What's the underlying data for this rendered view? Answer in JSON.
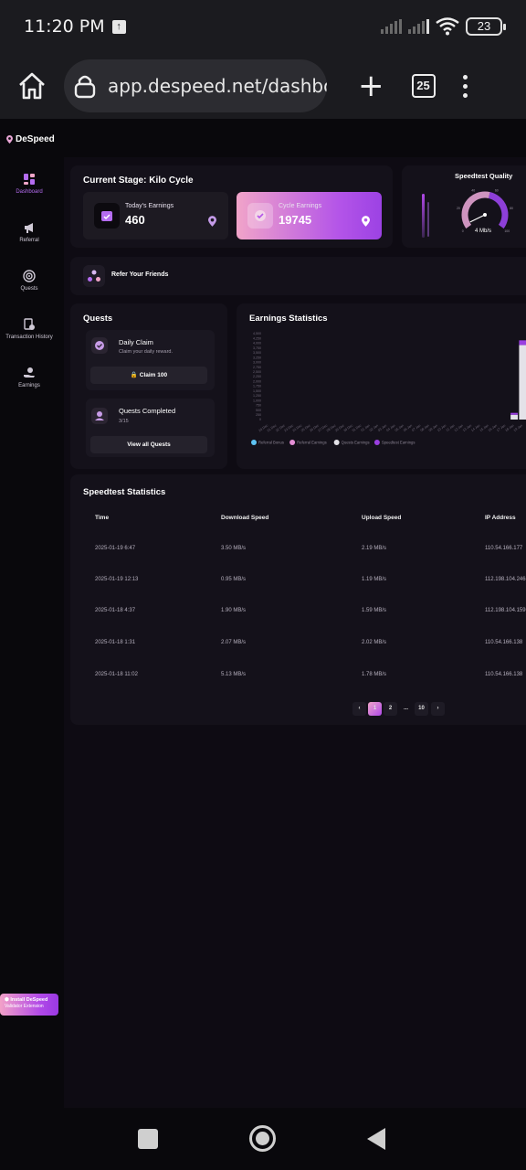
{
  "status": {
    "time": "11:20 PM",
    "battery": "23"
  },
  "browser": {
    "url": "app.despeed.net/dashboard",
    "tab_count": "25"
  },
  "brand": {
    "name": "DeSpeed"
  },
  "sidebar": {
    "items": [
      {
        "label": "Dashboard",
        "icon": "dashboard-icon"
      },
      {
        "label": "Referral",
        "icon": "megaphone-icon"
      },
      {
        "label": "Quests",
        "icon": "target-icon"
      },
      {
        "label": "Transaction History",
        "icon": "history-icon"
      },
      {
        "label": "Earnings",
        "icon": "earnings-icon"
      }
    ],
    "install_line1": "Install DeSpeed",
    "install_line2": "Validator Extension"
  },
  "stage": {
    "title": "Current Stage: Kilo Cycle",
    "today_label": "Today's Earnings",
    "today_value": "460",
    "cycle_label": "Cycle Earnings",
    "cycle_value": "19745"
  },
  "quality": {
    "title": "Speedtest Quality",
    "gauge_value": "4 Mb/s",
    "gauge_ticks": [
      "0",
      "20",
      "40",
      "60",
      "80",
      "100"
    ],
    "gauge_fraction": 0.04
  },
  "refer": {
    "label": "Refer Your Friends"
  },
  "quests": {
    "title": "Quests",
    "daily_title": "Daily Claim",
    "daily_desc": "Claim your daily reward.",
    "claim_button": "Claim 100",
    "completed_title": "Quests Completed",
    "completed_count": "3/15",
    "view_all_button": "View all Quests"
  },
  "chart_data": {
    "type": "bar",
    "title": "Earnings Statistics",
    "y_ticks": [
      "4,500",
      "4,250",
      "4,000",
      "3,750",
      "3,500",
      "3,250",
      "3,000",
      "2,750",
      "2,500",
      "2,250",
      "2,000",
      "1,750",
      "1,500",
      "1,250",
      "1,000",
      "750",
      "500",
      "250",
      "0"
    ],
    "ylim": [
      0,
      4500
    ],
    "categories": [
      "20 Dec",
      "21 Dec",
      "22 Dec",
      "23 Dec",
      "24 Dec",
      "25 Dec",
      "26 Dec",
      "27 Dec",
      "28 Dec",
      "29 Dec",
      "30 Dec",
      "31 Dec",
      "01 Jan",
      "02 Jan",
      "03 Jan",
      "04 Jan",
      "05 Jan",
      "06 Jan",
      "07 Jan",
      "08 Jan",
      "09 Jan",
      "10 Jan",
      "11 Jan",
      "12 Jan",
      "13 Jan",
      "14 Jan",
      "15 Jan",
      "16 Jan",
      "17 Jan",
      "18 Jan",
      "19 Jan"
    ],
    "series": [
      {
        "name": "Referral Bonus",
        "color": "#5ec3f2",
        "values": [
          0,
          0,
          0,
          0,
          0,
          0,
          0,
          0,
          0,
          0,
          0,
          0,
          0,
          0,
          0,
          0,
          0,
          0,
          0,
          0,
          0,
          0,
          0,
          0,
          0,
          0,
          0,
          0,
          0,
          0,
          0
        ]
      },
      {
        "name": "Referral Earnings",
        "color": "#e58fd6",
        "values": [
          0,
          0,
          0,
          0,
          0,
          0,
          0,
          0,
          0,
          0,
          0,
          0,
          0,
          0,
          0,
          0,
          0,
          0,
          0,
          0,
          0,
          0,
          0,
          0,
          0,
          0,
          0,
          0,
          0,
          0,
          0
        ]
      },
      {
        "name": "Quests Earnings",
        "color": "#e4e2e8",
        "values": [
          0,
          0,
          0,
          0,
          0,
          0,
          0,
          0,
          0,
          0,
          0,
          0,
          0,
          0,
          0,
          0,
          0,
          0,
          0,
          0,
          0,
          0,
          0,
          0,
          0,
          0,
          0,
          0,
          0,
          250,
          3900
        ]
      },
      {
        "name": "Speedtest Earnings",
        "color": "#9a3fe0",
        "values": [
          0,
          0,
          0,
          0,
          0,
          0,
          0,
          0,
          0,
          0,
          0,
          0,
          0,
          0,
          0,
          0,
          0,
          0,
          0,
          0,
          0,
          0,
          0,
          0,
          0,
          0,
          0,
          0,
          0,
          100,
          250
        ]
      }
    ],
    "legend_position": "bottom"
  },
  "speedtest": {
    "title": "Speedtest Statistics",
    "columns": [
      "Time",
      "Download Speed",
      "Upload Speed",
      "IP Address"
    ],
    "rows": [
      [
        "2025-01-19 6:47",
        "3.50 MB/s",
        "2.19 MB/s",
        "110.54.166.177"
      ],
      [
        "2025-01-19 12:13",
        "0.95 MB/s",
        "1.19 MB/s",
        "112.198.104.246"
      ],
      [
        "2025-01-18 4:37",
        "1.90 MB/s",
        "1.59 MB/s",
        "112.198.104.159"
      ],
      [
        "2025-01-18 1:31",
        "2.07 MB/s",
        "2.02 MB/s",
        "110.54.166.138"
      ],
      [
        "2025-01-18 11:02",
        "5.13 MB/s",
        "1.78 MB/s",
        "110.54.166.138"
      ]
    ],
    "pagination": {
      "prev": "‹",
      "pages": [
        "1",
        "2",
        "...",
        "10"
      ],
      "next": "›",
      "current": "1"
    }
  },
  "colors": {
    "accent": "#b048e8",
    "pink": "#f0a6c9",
    "bg": "#0e0b13",
    "card": "#14111a"
  }
}
